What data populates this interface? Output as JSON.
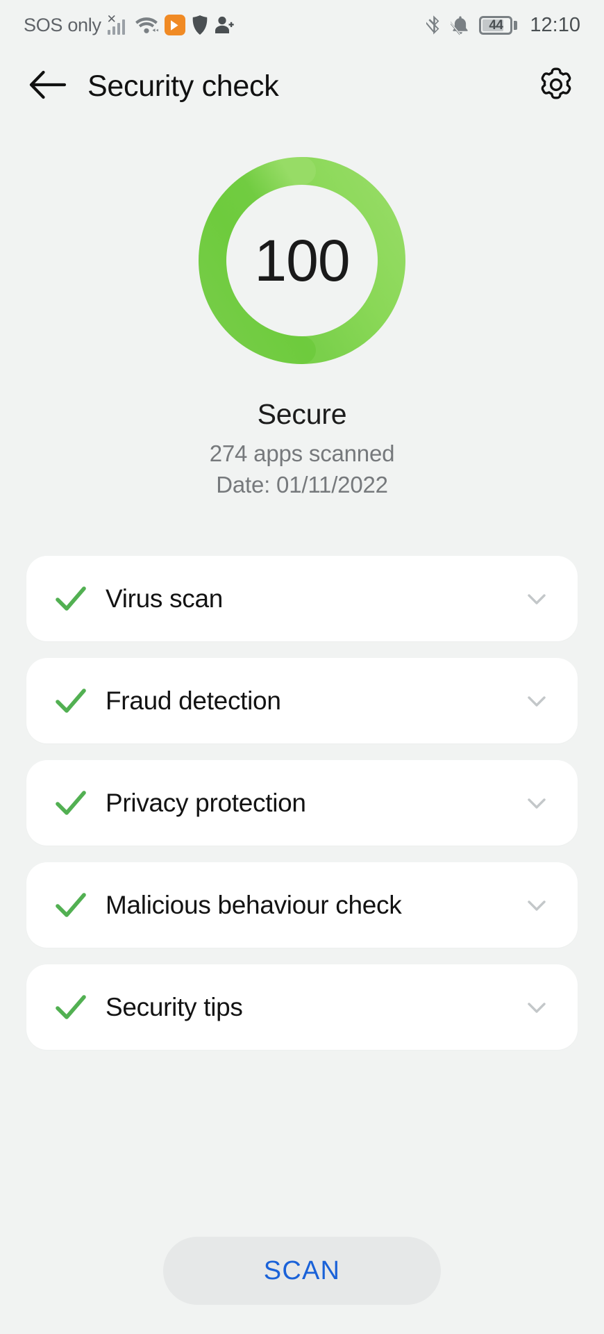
{
  "status_bar": {
    "carrier": "SOS only",
    "time": "12:10",
    "battery_level": "44",
    "icons": [
      "signal-no-service-icon",
      "wifi-icon",
      "play-store-icon",
      "shield-icon",
      "person-add-icon",
      "bluetooth-icon",
      "notifications-silenced-icon",
      "battery-icon"
    ]
  },
  "app_bar": {
    "back_icon": "back-arrow-icon",
    "title": "Security check",
    "settings_icon": "gear-icon"
  },
  "score": {
    "value": "100",
    "status": "Secure",
    "apps_scanned": "274 apps scanned",
    "date": "Date: 01/11/2022",
    "ring_color_dark": "#6ecb3d",
    "ring_color_light": "#95db63",
    "percent": 100
  },
  "checks": [
    {
      "label": "Virus scan",
      "status_icon": "check-icon",
      "expand_icon": "chevron-down-icon"
    },
    {
      "label": "Fraud detection",
      "status_icon": "check-icon",
      "expand_icon": "chevron-down-icon"
    },
    {
      "label": "Privacy protection",
      "status_icon": "check-icon",
      "expand_icon": "chevron-down-icon"
    },
    {
      "label": "Malicious behaviour check",
      "status_icon": "check-icon",
      "expand_icon": "chevron-down-icon"
    },
    {
      "label": "Security tips",
      "status_icon": "check-icon",
      "expand_icon": "chevron-down-icon"
    }
  ],
  "action": {
    "scan_label": "SCAN",
    "scan_text_color": "#1a62d8",
    "scan_bg_color": "#e6e8e8"
  },
  "theme": {
    "background": "#f1f3f2",
    "card_background": "#ffffff",
    "check_green": "#52b052",
    "title_color": "#111111",
    "muted_text": "#76797c"
  }
}
